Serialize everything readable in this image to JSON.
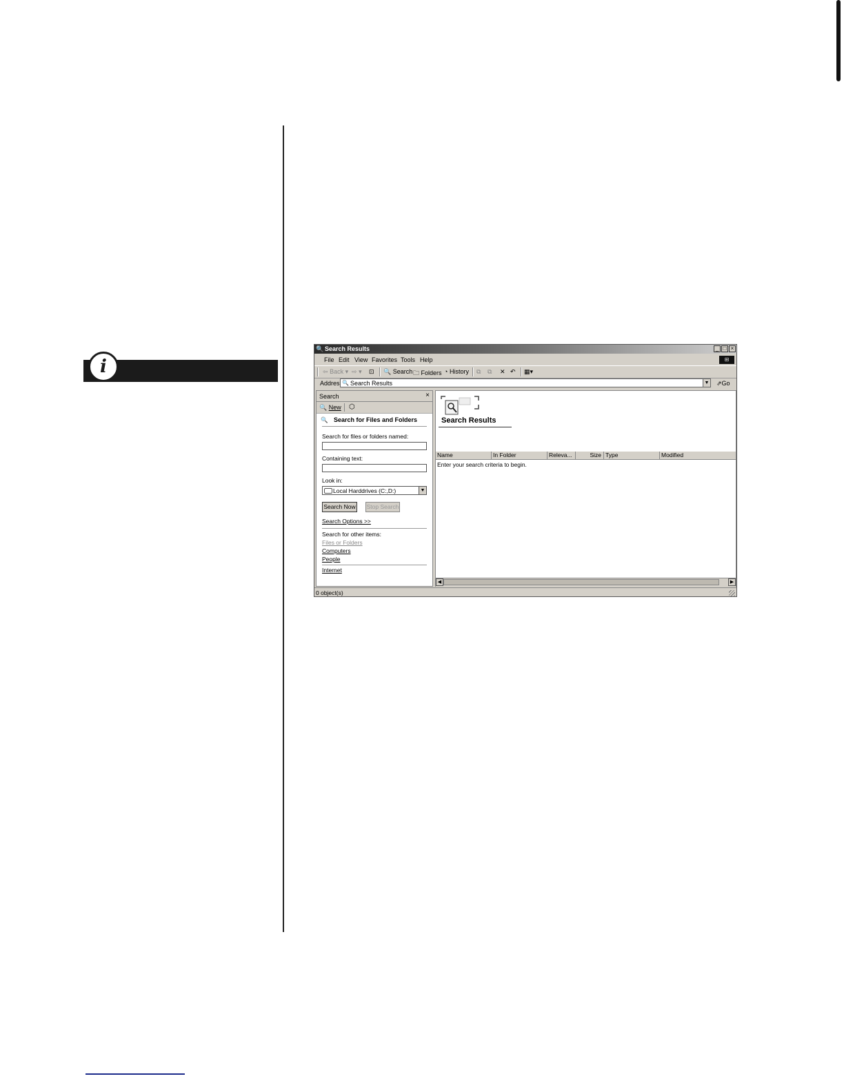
{
  "window": {
    "title": "Search Results",
    "controls": {
      "minimize": "_",
      "maximize": "□",
      "close": "×"
    }
  },
  "menu": [
    "File",
    "Edit",
    "View",
    "Favorites",
    "Tools",
    "Help"
  ],
  "toolbar": {
    "back": "Back",
    "search": "Search",
    "folders": "Folders",
    "history": "History"
  },
  "address": {
    "label": "Address",
    "value": "Search Results",
    "go": "Go"
  },
  "search_pane": {
    "title": "Search",
    "new_label": "New",
    "heading": "Search for Files and Folders",
    "named_label": "Search for files or folders named:",
    "named_value": "",
    "containing_label": "Containing text:",
    "containing_value": "",
    "lookin_label": "Look in:",
    "lookin_value": "Local Harddrives (C:,D:)",
    "search_now": "Search Now",
    "stop_search": "Stop Search",
    "options_link": "Search Options >>",
    "other_label": "Search for other items:",
    "other_items": [
      "Files or Folders",
      "Computers",
      "People"
    ],
    "internet": "Internet"
  },
  "results": {
    "title": "Search Results",
    "columns": [
      "Name",
      "In Folder",
      "Releva...",
      "Size",
      "Type",
      "Modified"
    ],
    "message": "Enter your search criteria to begin."
  },
  "status": {
    "text": "0 object(s)"
  }
}
